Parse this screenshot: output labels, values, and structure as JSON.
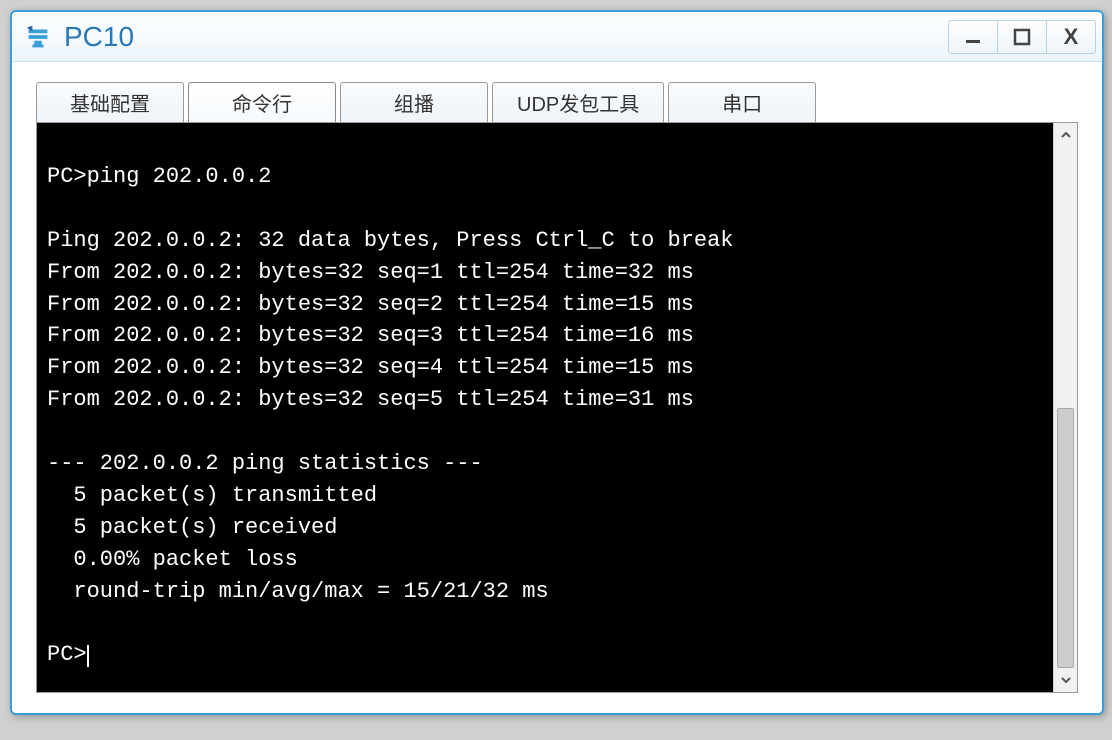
{
  "window": {
    "title": "PC10"
  },
  "tabs": [
    {
      "label": "基础配置"
    },
    {
      "label": "命令行"
    },
    {
      "label": "组播"
    },
    {
      "label": "UDP发包工具"
    },
    {
      "label": "串口"
    }
  ],
  "terminal": {
    "lines": [
      "PC>ping 202.0.0.2",
      "",
      "Ping 202.0.0.2: 32 data bytes, Press Ctrl_C to break",
      "From 202.0.0.2: bytes=32 seq=1 ttl=254 time=32 ms",
      "From 202.0.0.2: bytes=32 seq=2 ttl=254 time=15 ms",
      "From 202.0.0.2: bytes=32 seq=3 ttl=254 time=16 ms",
      "From 202.0.0.2: bytes=32 seq=4 ttl=254 time=15 ms",
      "From 202.0.0.2: bytes=32 seq=5 ttl=254 time=31 ms",
      "",
      "--- 202.0.0.2 ping statistics ---",
      "  5 packet(s) transmitted",
      "  5 packet(s) received",
      "  0.00% packet loss",
      "  round-trip min/avg/max = 15/21/32 ms",
      ""
    ],
    "prompt": "PC>"
  }
}
